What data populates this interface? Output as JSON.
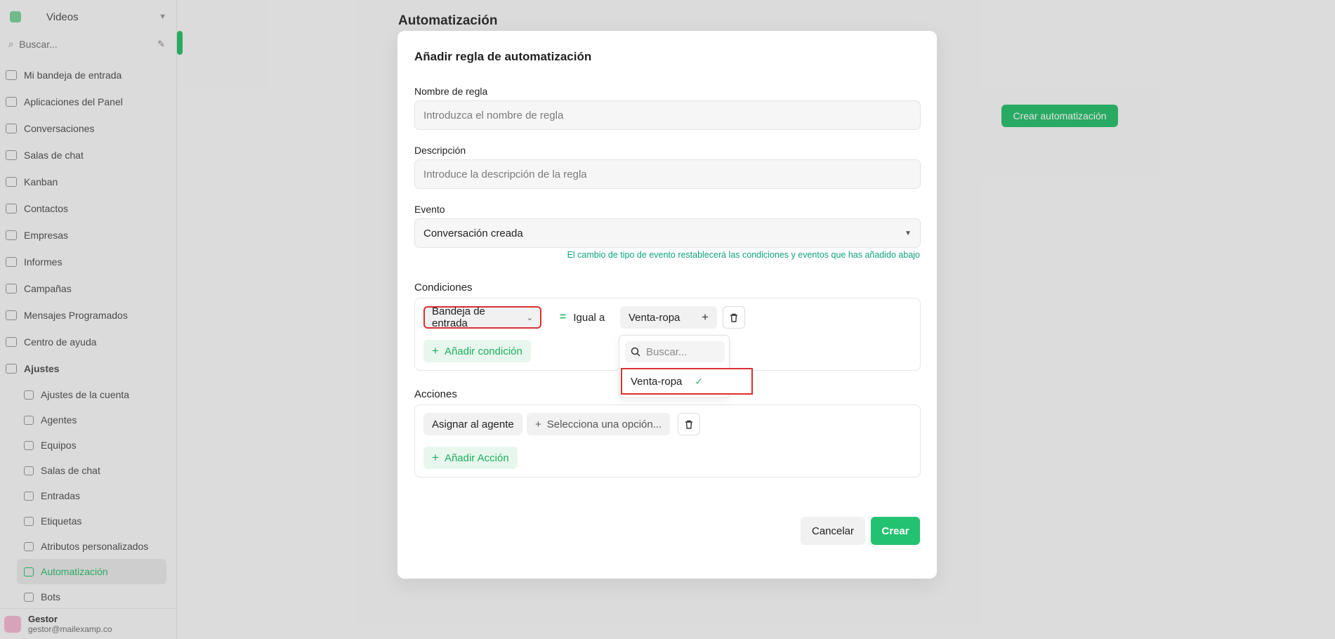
{
  "app": {
    "workspace": "Videos",
    "search_placeholder": "Buscar...",
    "page_title": "Automatización",
    "create_button": "Crear automatización"
  },
  "sidebar": {
    "items": [
      {
        "label": "Mi bandeja de entrada",
        "icon": "inbox-icon"
      },
      {
        "label": "Aplicaciones del Panel",
        "icon": "grid-icon"
      },
      {
        "label": "Conversaciones",
        "icon": "chat-icon"
      },
      {
        "label": "Salas de chat",
        "icon": "room-icon"
      },
      {
        "label": "Kanban",
        "icon": "kanban-icon"
      },
      {
        "label": "Contactos",
        "icon": "contacts-icon"
      },
      {
        "label": "Empresas",
        "icon": "building-icon"
      },
      {
        "label": "Informes",
        "icon": "reports-icon"
      },
      {
        "label": "Campañas",
        "icon": "megaphone-icon"
      },
      {
        "label": "Mensajes Programados",
        "icon": "schedule-icon"
      },
      {
        "label": "Centro de ayuda",
        "icon": "help-icon"
      },
      {
        "label": "Ajustes",
        "icon": "settings-icon"
      }
    ],
    "subitems": [
      {
        "label": "Ajustes de la cuenta",
        "icon": "account-icon"
      },
      {
        "label": "Agentes",
        "icon": "agents-icon"
      },
      {
        "label": "Equipos",
        "icon": "teams-icon"
      },
      {
        "label": "Salas de chat",
        "icon": "room-icon"
      },
      {
        "label": "Entradas",
        "icon": "inboxes-icon"
      },
      {
        "label": "Etiquetas",
        "icon": "tag-icon"
      },
      {
        "label": "Atributos personalizados",
        "icon": "code-icon"
      },
      {
        "label": "Automatización",
        "icon": "automation-icon"
      },
      {
        "label": "Bots",
        "icon": "bot-icon"
      }
    ],
    "user": {
      "name": "Gestor",
      "email": "gestor@mailexamp.co"
    }
  },
  "modal": {
    "title": "Añadir regla de automatización",
    "name_label": "Nombre de regla",
    "name_placeholder": "Introduzca el nombre de regla",
    "description_label": "Descripción",
    "description_placeholder": "Introduce la descripción de la regla",
    "event_label": "Evento",
    "event_value": "Conversación creada",
    "event_helper": "El cambio de tipo de evento restablecerá las condiciones y eventos que has añadido abajo",
    "conditions": {
      "label": "Condiciones",
      "attribute": "Bandeja de entrada",
      "operator": "Igual a",
      "value": "Venta-ropa",
      "add_label": "Añadir condición",
      "dropdown": {
        "search_placeholder": "Buscar...",
        "options": [
          {
            "label": "Venta-ropa",
            "selected": true
          }
        ]
      }
    },
    "actions": {
      "label": "Acciones",
      "action": "Asignar al agente",
      "value_placeholder": "Selecciona una opción...",
      "add_label": "Añadir Acción"
    },
    "cancel_label": "Cancelar",
    "create_label": "Crear"
  },
  "colors": {
    "accent": "#23c270",
    "highlight": "#d93131",
    "helper_text": "#10a37f"
  }
}
